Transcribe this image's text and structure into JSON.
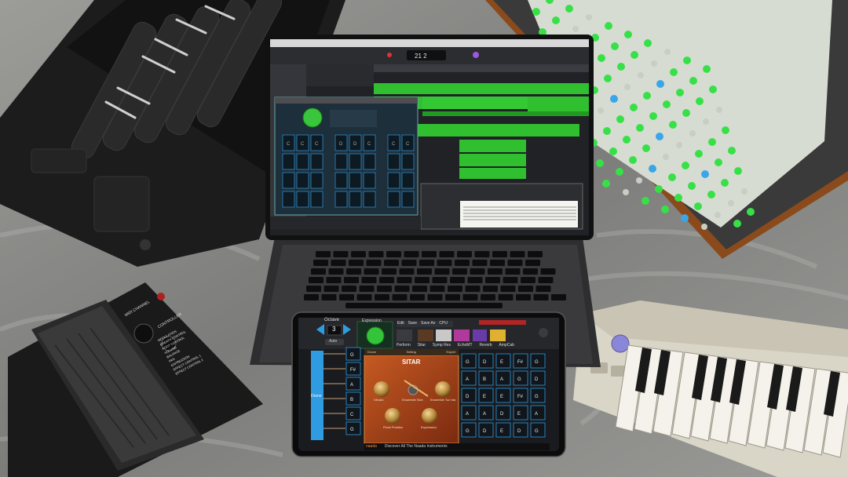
{
  "ipad": {
    "octave_label": "Octave",
    "octave_value": "3",
    "auto_label": "Auto",
    "expression_label": "Expression",
    "menu": [
      "Edit",
      "Save",
      "Save As",
      "CPU"
    ],
    "instrument_tabs": [
      "Perform",
      "Sitar",
      "Symp Res",
      "EchoMT",
      "Reverb",
      "AmpCab"
    ],
    "panel_tabs": [
      "Drone",
      "Setting",
      "Expert"
    ],
    "instrument_title": "SITAR",
    "knobs": [
      "Vibrato",
      "Ensemble Size",
      "Ensemble Tun Var",
      "Pluck Position",
      "Expression"
    ],
    "drone_label": "Drone",
    "grid_left": [
      "G",
      "F#",
      "A",
      "B",
      "C",
      "G"
    ],
    "grid_right": [
      [
        "G",
        "D",
        "E",
        "F#",
        "G"
      ],
      [
        "A",
        "B",
        "A",
        "G",
        "D"
      ],
      [
        "D",
        "E",
        "E",
        "F#",
        "G"
      ],
      [
        "A",
        "A",
        "D",
        "E",
        "A"
      ],
      [
        "G",
        "D",
        "E",
        "D",
        "G"
      ]
    ],
    "footer_logo": "naada",
    "footer_text": "Discover All The Naada Instruments"
  },
  "laptop": {
    "mini_pads": [
      "C",
      "C",
      "C",
      "D",
      "D",
      "C",
      "C",
      "C"
    ],
    "transport_time": "21 2"
  },
  "pedal": {
    "label_top": "MIDI CHANNEL",
    "label_controller": "CONTROLLER",
    "list": [
      "MODULATION",
      "BREATH CONTROL",
      "FOOT CONTROL",
      "VOLUME",
      "BALANCE",
      "PAN",
      "EXPRESSION",
      "EFFECT CONTROL 1",
      "EFFECT CONTROL 2"
    ]
  },
  "colors": {
    "green_pad": "#38e048",
    "blue_pad": "#3aa6e8",
    "daw_green": "#2fbf2f",
    "ipad_accent": "#2f9be0",
    "sitar_panel": "#b54a1e"
  }
}
